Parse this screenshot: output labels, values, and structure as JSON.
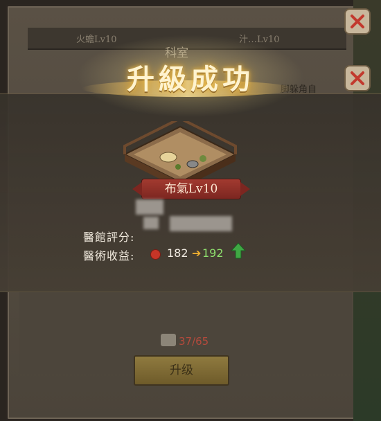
{
  "background": {
    "tab_left": "火蟾Lv10",
    "tab_right": "汁…Lv10",
    "panel_title": "科室",
    "right_text": "脚躲角自",
    "progress": "37/65",
    "upgrade_button": "升级"
  },
  "popup": {
    "title": "升級成功",
    "room_level": "布氣Lv10",
    "rating_label": "醫館評分:",
    "income_label": "醫術收益:",
    "income_old": "182",
    "income_arrow": "➔",
    "income_new": "192"
  },
  "colors": {
    "accent_gold": "#f2dc9a",
    "ribbon_red": "#a23a30",
    "increase_green": "#8fe06e"
  }
}
